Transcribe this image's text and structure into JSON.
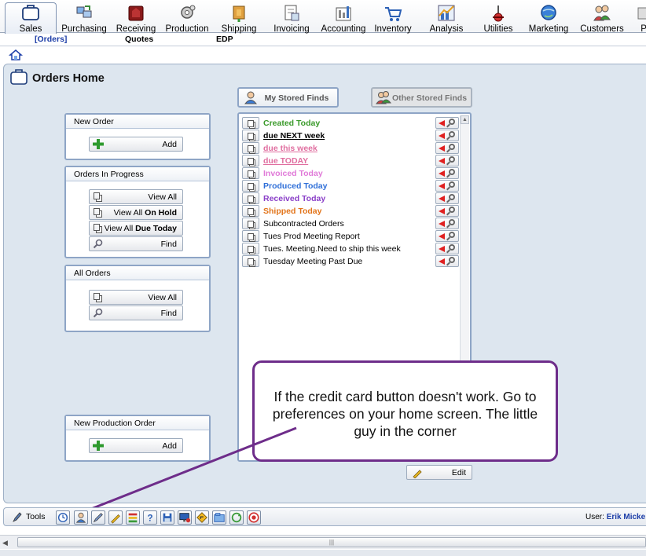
{
  "nav": {
    "modules": [
      {
        "label": "Sales",
        "icon": "sales-icon",
        "active": true
      },
      {
        "label": "Purchasing",
        "icon": "purchasing-icon"
      },
      {
        "label": "Receiving",
        "icon": "receiving-icon"
      },
      {
        "label": "Production",
        "icon": "production-icon"
      },
      {
        "label": "Shipping",
        "icon": "shipping-icon"
      },
      {
        "label": "Invoicing",
        "icon": "invoicing-icon"
      },
      {
        "label": "Accounting",
        "icon": "accounting-icon"
      },
      {
        "label": "Inventory",
        "icon": "inventory-icon"
      },
      {
        "label": "Analysis",
        "icon": "analysis-icon"
      },
      {
        "label": "Utilities",
        "icon": "utilities-icon"
      },
      {
        "label": "Marketing",
        "icon": "marketing-icon"
      },
      {
        "label": "Customers",
        "icon": "customers-icon"
      },
      {
        "label": "Pr",
        "icon": "partial-icon"
      }
    ],
    "sub": [
      {
        "label": "[Orders]",
        "selected": true
      },
      {
        "label": "Quotes"
      },
      {
        "label": "EDP"
      }
    ]
  },
  "page": {
    "title": "Orders Home"
  },
  "groups": {
    "new_order": {
      "title": "New Order",
      "add_label": "Add"
    },
    "in_progress": {
      "title": "Orders In Progress",
      "view_all": "View All",
      "view_all_prefix": "View All ",
      "on_hold": "On Hold",
      "due_today": "Due Today",
      "find": "Find"
    },
    "all_orders": {
      "title": "All Orders",
      "view_all": "View All",
      "find": "Find"
    },
    "new_production": {
      "title": "New Production Order",
      "add_label": "Add"
    }
  },
  "finds_tabs": {
    "mine": "My Stored Finds",
    "other": "Other Stored Finds"
  },
  "finds": [
    {
      "label": "Created Today",
      "color": "#3a9a2a",
      "bold": true,
      "underline": false
    },
    {
      "label": "due NEXT week",
      "color": "#000000",
      "bold": true,
      "underline": true
    },
    {
      "label": "due this week",
      "color": "#e06fa0",
      "bold": true,
      "underline": true
    },
    {
      "label": "due TODAY",
      "color": "#e06fa0",
      "bold": true,
      "underline": true
    },
    {
      "label": "Invoiced Today",
      "color": "#e07ad8",
      "bold": true,
      "underline": false
    },
    {
      "label": "Produced Today",
      "color": "#2f6fd8",
      "bold": true,
      "underline": false
    },
    {
      "label": "Received Today",
      "color": "#8a3fc8",
      "bold": true,
      "underline": false
    },
    {
      "label": "Shipped Today",
      "color": "#e2741a",
      "bold": true,
      "underline": false
    },
    {
      "label": "Subcontracted Orders",
      "color": "#000000",
      "bold": false,
      "underline": false
    },
    {
      "label": "Tues Prod Meeting Report",
      "color": "#000000",
      "bold": false,
      "underline": false
    },
    {
      "label": "Tues. Meeting.Need to ship this week",
      "color": "#000000",
      "bold": false,
      "underline": false
    },
    {
      "label": "Tuesday Meeting Past Due",
      "color": "#000000",
      "bold": false,
      "underline": false
    }
  ],
  "edit_label": "Edit",
  "callout": {
    "text": "If the credit card button doesn't work. Go to preferences on your home screen. The little guy in the corner"
  },
  "toolbar": {
    "tools_label": "Tools",
    "user_prefix": "User:",
    "user_name": "Erik Micke"
  },
  "colors": {
    "accent": "#1d3ea8",
    "callout_border": "#6e2d8a",
    "panel_bg": "#dde6ef"
  }
}
